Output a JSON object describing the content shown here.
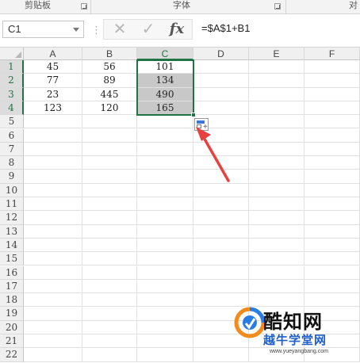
{
  "ribbon": {
    "groups": [
      {
        "label": "剪贴板",
        "has_launcher": true
      },
      {
        "label": "字体",
        "has_launcher": true
      },
      {
        "label": "对",
        "has_launcher": false
      }
    ]
  },
  "formula_bar": {
    "name_box": "C1",
    "cancel_icon": "close-icon",
    "enter_icon": "check-icon",
    "fx_label": "fx",
    "formula": "=$A$1+B1"
  },
  "sheet": {
    "columns": [
      "A",
      "B",
      "C",
      "D",
      "E",
      "F"
    ],
    "active_column": "C",
    "rows": [
      "1",
      "2",
      "3",
      "4",
      "5",
      "6",
      "7",
      "8",
      "9",
      "10",
      "11",
      "12",
      "13",
      "14",
      "15",
      "16",
      "17",
      "18",
      "19",
      "20",
      "21",
      "22"
    ],
    "active_rows": [
      "1",
      "2",
      "3",
      "4"
    ],
    "data": [
      [
        "45",
        "56",
        "101"
      ],
      [
        "77",
        "89",
        "134"
      ],
      [
        "23",
        "445",
        "490"
      ],
      [
        "123",
        "120",
        "165"
      ]
    ],
    "selection": "C1:C4"
  },
  "auto_fill_options_icon": "paste-options-icon",
  "annotation": {
    "arrow_color": "#e8403e"
  },
  "watermark": {
    "title": "酷知网",
    "subtitle": "越牛学堂网",
    "url": "www.yueyangbang.com"
  },
  "colors": {
    "accent": "#217346",
    "selection_fill": "#c8c8c8",
    "arrow": "#e8403e",
    "watermark_blue": "#1e5fc9"
  }
}
